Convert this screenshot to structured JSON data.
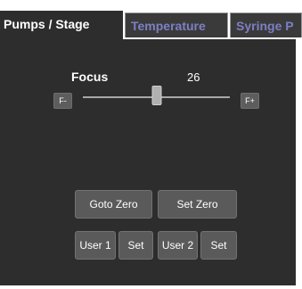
{
  "tabs": [
    {
      "label": "Pumps / Stage",
      "active": true
    },
    {
      "label": "Temperature",
      "active": false
    },
    {
      "label": "Syringe P",
      "active": false
    }
  ],
  "focus": {
    "label": "Focus",
    "value": "26",
    "minus_label": "F-",
    "plus_label": "F+",
    "slider_min": 0,
    "slider_max": 100,
    "slider_value": 50
  },
  "buttons": {
    "goto_zero": "Goto Zero",
    "set_zero": "Set Zero",
    "user1": "User 1",
    "set1": "Set",
    "user2": "User 2",
    "set2": "Set"
  },
  "colors": {
    "panel_bg": "#2d2d2d",
    "inactive_tab_text": "#7d7fc4",
    "button_bg": "#5a5a5a"
  }
}
